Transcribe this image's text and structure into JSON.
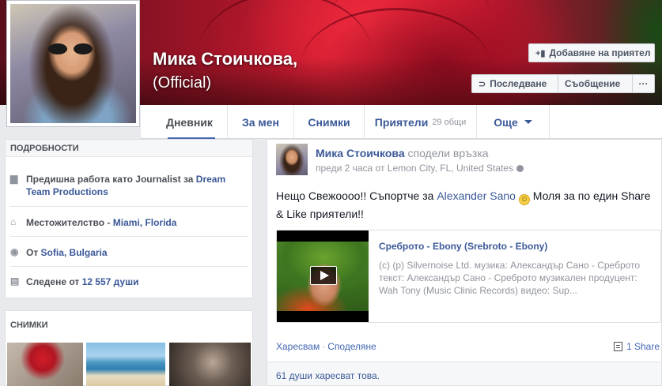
{
  "profile": {
    "name": "Мика Стоичкова,",
    "subtitle": "(Official)",
    "add_friend_label": "Добавяне на приятел",
    "follow_label": "Последване",
    "message_label": "Съобщение",
    "more_label": "···"
  },
  "nav": {
    "timeline": "Дневник",
    "about": "За мен",
    "photos": "Снимки",
    "friends": "Приятели",
    "friends_count": "29 общи",
    "more": "Още"
  },
  "about": {
    "title": "ПОДРОБНОСТИ",
    "work_prefix": "Предишна работа като Journalist за ",
    "work_company": "Dream Team Productions",
    "residence_prefix": "Местожителство - ",
    "residence_place": "Miami, Florida",
    "from_prefix": "От ",
    "from_place": "Sofia, Bulgaria",
    "followers_prefix": "Следене от ",
    "followers_count": "12 557 души"
  },
  "photos": {
    "title": "СНИМКИ"
  },
  "post": {
    "author": "Мика Стоичкова",
    "action": "сподели връзка",
    "meta": "преди 2 часа от Lemon City, FL, United States",
    "text_before": "Нещо Свежоооо!! Съпортче за ",
    "mention": "Alexander Sano",
    "emoji": "☺",
    "text_after": " Моля за по един Share & Like приятели!!",
    "link_title": "Среброто - Ebony (Srebroto - Ebony)",
    "link_description": "(c) (p) Silvernoise Ltd. музика: Александър Сано - Среброто текст: Александър Сано - Среброто музикален продуцент: Wah Tony (Music Clinic Records) видео: Sup...",
    "like_label": "Харесвам",
    "dot": "·",
    "share_label": "Споделяне",
    "share_count": "1 Share",
    "likes_summary": "61 души харесват това."
  },
  "colors": {
    "link": "#3b5998",
    "muted": "#90949c",
    "background": "#e9eaed"
  }
}
